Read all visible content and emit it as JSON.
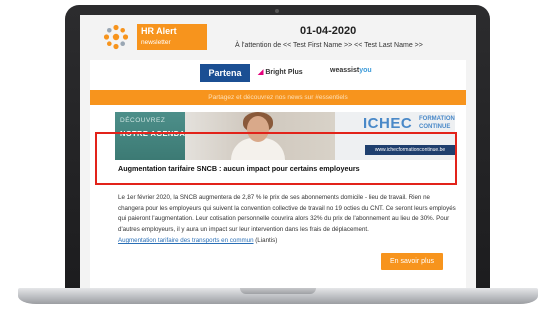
{
  "newsletter": {
    "brand_title": "HR Alert",
    "brand_subtitle": "newsletter",
    "date": "01-04-2020",
    "attention_line": "À l'attention de << Test First Name >> << Test Last Name >>"
  },
  "partners": {
    "partena": "Partena",
    "brightplus": "Bright Plus",
    "weassist_prefix": "weassist",
    "weassist_suffix": "you"
  },
  "orange_bar_text": "Partagez et découvrez nos news sur #essentiels",
  "banner": {
    "decouvrez": "DÉCOUVREZ",
    "agenda": "NOTRE AGENDA",
    "ichec": "ICHEC",
    "ichec_formation": "FORMATION",
    "ichec_continue": "CONTINUE",
    "ichec_url": "www.ichecformationcontinue.be"
  },
  "article": {
    "title": "Augmentation tarifaire SNCB : aucun impact pour certains employeurs",
    "body": "Le 1er février 2020, la SNCB augmentera de 2,87 % le prix de ses abonnements domicile - lieu de travail. Rien ne changera pour les employeurs qui suivent la convention collective de travail no 19 octies du CNT. Ce seront leurs employés qui paieront l'augmentation. Leur cotisation personnelle couvrira alors 32% du prix de l'abonnement au lieu de 30%. Pour d'autres employeurs, il y aura un impact sur leur intervention dans les frais de déplacement.",
    "link_text": "Augmentation tarifaire des transports en commun",
    "link_suffix": "(Liantis)",
    "button": "En savoir plus"
  },
  "colors": {
    "accent_orange": "#f7941d",
    "highlight_red": "#e2231a",
    "partena_blue": "#1b4f93",
    "banner_teal": "#4d8f8a"
  }
}
